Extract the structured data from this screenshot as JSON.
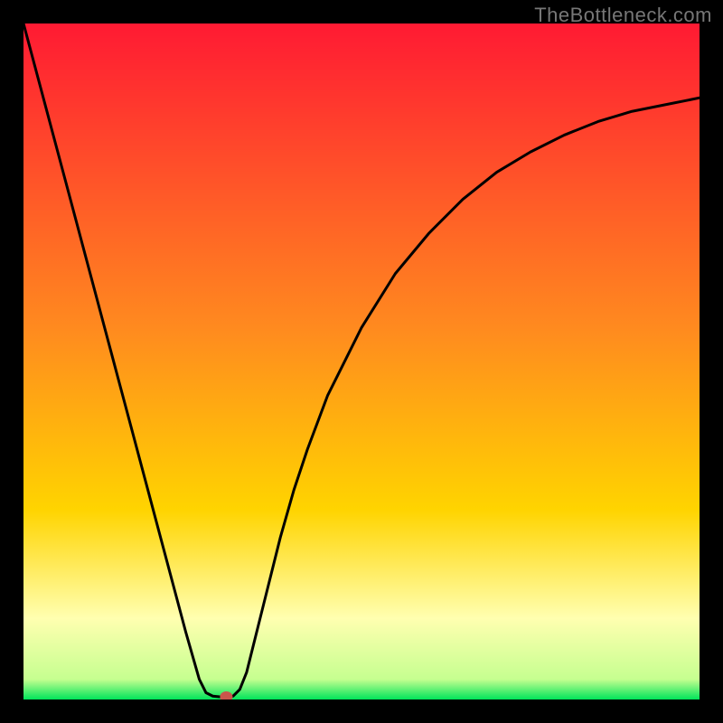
{
  "watermark": "TheBottleneck.com",
  "chart_data": {
    "type": "line",
    "title": "",
    "xlabel": "",
    "ylabel": "",
    "xlim": [
      0,
      100
    ],
    "ylim": [
      0,
      100
    ],
    "series": [
      {
        "name": "bottleneck-curve",
        "x": [
          0,
          2,
          4,
          6,
          8,
          10,
          12,
          14,
          16,
          18,
          20,
          22,
          24,
          26,
          27,
          28,
          29,
          30,
          31,
          32,
          33,
          34,
          36,
          38,
          40,
          42,
          45,
          50,
          55,
          60,
          65,
          70,
          75,
          80,
          85,
          90,
          95,
          100
        ],
        "y": [
          100,
          92.5,
          85,
          77.5,
          70,
          62.5,
          55,
          47.5,
          40,
          32.5,
          25,
          17.5,
          10,
          3,
          1,
          0.5,
          0.4,
          0.4,
          0.5,
          1.5,
          4,
          8,
          16,
          24,
          31,
          37,
          45,
          55,
          63,
          69,
          74,
          78,
          81,
          83.5,
          85.5,
          87,
          88,
          89
        ]
      }
    ],
    "marker": {
      "x": 30,
      "y": 0.4
    },
    "background_gradient": {
      "top_color": "#ff1a33",
      "mid_color": "#ffd400",
      "pale_band": "#ffffb0",
      "bottom_color": "#00e45a"
    }
  }
}
